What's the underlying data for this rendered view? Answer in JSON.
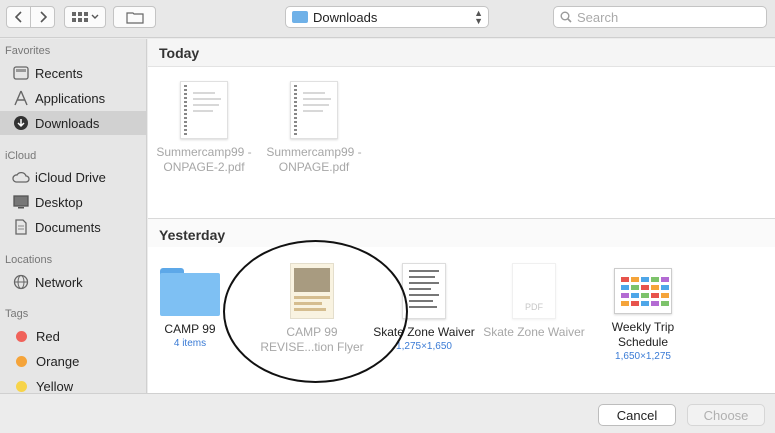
{
  "toolbar": {
    "location": "Downloads",
    "search_placeholder": "Search"
  },
  "sidebar": {
    "sections": [
      {
        "title": "Favorites"
      },
      {
        "title": "iCloud"
      },
      {
        "title": "Locations"
      },
      {
        "title": "Tags"
      }
    ],
    "items": [
      {
        "label": "Recents",
        "icon": "recents-icon"
      },
      {
        "label": "Applications",
        "icon": "applications-icon"
      },
      {
        "label": "Downloads",
        "icon": "downloads-icon",
        "selected": true
      },
      {
        "label": "iCloud Drive",
        "icon": "cloud-icon"
      },
      {
        "label": "Desktop",
        "icon": "desktop-icon"
      },
      {
        "label": "Documents",
        "icon": "documents-icon"
      },
      {
        "label": "Network",
        "icon": "globe-icon"
      },
      {
        "label": "Red",
        "color": "#f0625a"
      },
      {
        "label": "Orange",
        "color": "#f5a43a"
      },
      {
        "label": "Yellow",
        "color": "#f7d44a"
      }
    ]
  },
  "main": {
    "today": {
      "title": "Today",
      "files": [
        {
          "name": "Summercamp99 - ONPAGE-2.pdf",
          "kind": "pdf"
        },
        {
          "name": "Summercamp99 - ONPAGE.pdf",
          "kind": "pdf"
        }
      ]
    },
    "yesterday": {
      "title": "Yesterday",
      "files": [
        {
          "name": "CAMP 99",
          "meta": "4 items",
          "kind": "folder"
        },
        {
          "name": "CAMP 99 REVISE...tion Flyer",
          "kind": "image",
          "dimmed": true
        },
        {
          "name": "Skate Zone Waiver",
          "meta": "1,275×1,650",
          "kind": "image"
        },
        {
          "name": "Skate Zone Waiver",
          "kind": "pdf",
          "dimmed": true
        },
        {
          "name": "Weekly Trip Schedule",
          "meta": "1,650×1,275",
          "kind": "image"
        }
      ]
    }
  },
  "footer": {
    "cancel": "Cancel",
    "choose": "Choose"
  }
}
